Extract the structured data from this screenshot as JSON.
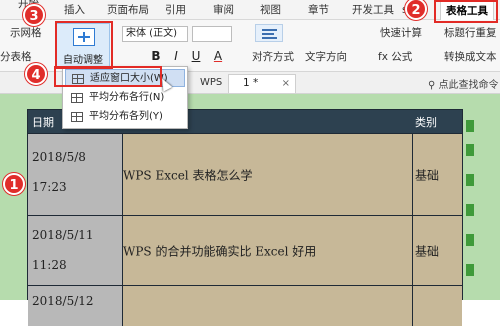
{
  "tabs": {
    "start": "开始",
    "insert": "插入",
    "page_layout": "页面布局",
    "reference": "引用",
    "review": "审阅",
    "view": "视图",
    "section": "章节",
    "dev_tools": "开发工具",
    "partial_s": "s",
    "table_tools": "表格工具"
  },
  "ribbon": {
    "grid_lines": "示网格",
    "split_table": "分表格",
    "auto_fit": "自动调整",
    "font_name": "宋体 (正文)",
    "bold": "B",
    "italic": "I",
    "underline": "U",
    "font_color": "A",
    "align": "对齐方式",
    "text_direction": "文字方向",
    "quick_calc": "快速计算",
    "formula": "fx 公式",
    "repeat_header": "标题行重复",
    "convert_text": "转换成文本"
  },
  "docbar": {
    "wps_label": "WPS",
    "doc_name": "1 *",
    "close": "×",
    "search_hint": "点此查找命令"
  },
  "dropdown": {
    "items": [
      "适应窗口大小(W)",
      "平均分布各行(N)",
      "平均分布各列(Y)"
    ]
  },
  "table": {
    "header_date": "日期",
    "header_category": "类别",
    "rows": [
      {
        "date": "2018/5/8",
        "time": "17:23",
        "title": "WPS Excel 表格怎么学",
        "category": "基础"
      },
      {
        "date": "2018/5/11",
        "time": "11:28",
        "title": "WPS 的合并功能确实比 Excel 好用",
        "category": "基础"
      },
      {
        "date": "2018/5/12",
        "time": "",
        "title": "",
        "category": ""
      }
    ]
  },
  "badges": [
    "1",
    "2",
    "3",
    "4"
  ],
  "colors": {
    "annotation_red": "#e02d2a",
    "table_header": "#2d4150",
    "sheet_bg": "#b6dcad",
    "cell_tan": "#c7b898",
    "cell_gray": "#b8b8b8"
  }
}
